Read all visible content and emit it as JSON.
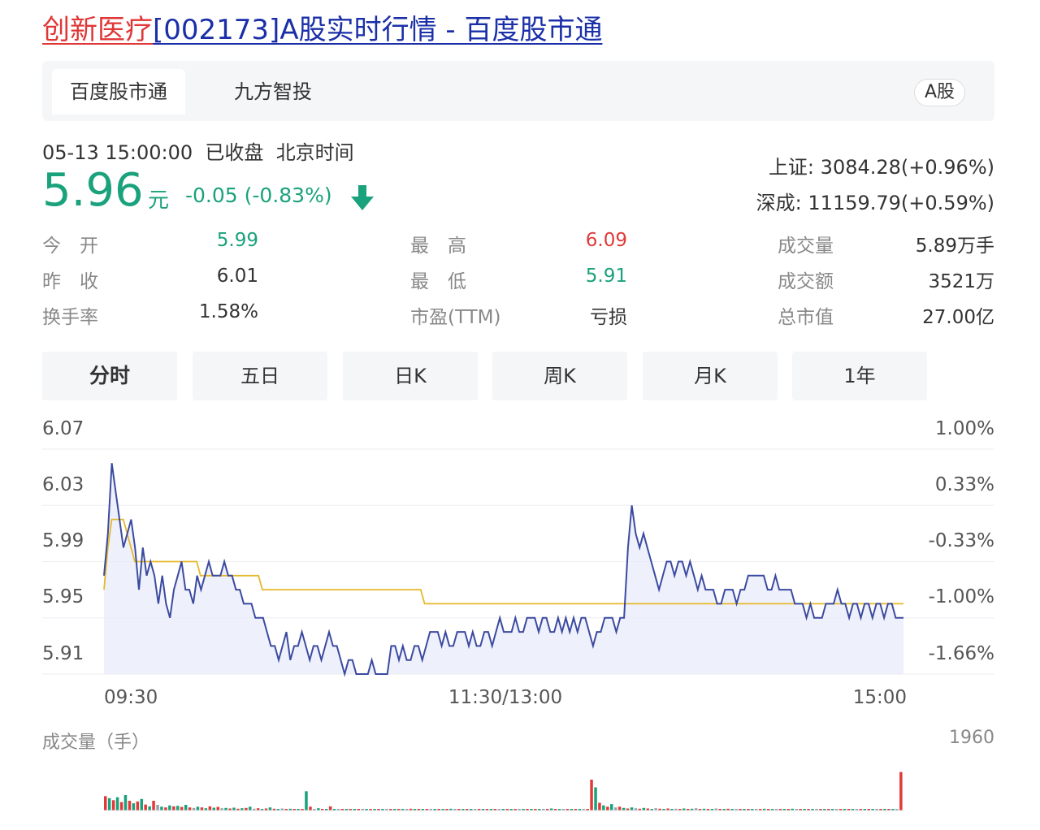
{
  "header": {
    "title_part1": "创新医疗",
    "title_part2": "[002173]A股实时行情 - 百度股市通"
  },
  "source_tabs": [
    {
      "label": "百度股市通",
      "active": true
    },
    {
      "label": "九方智投",
      "active": false
    }
  ],
  "market_badge": "A股",
  "status": {
    "datetime": "05-13 15:00:00",
    "state": "已收盘",
    "timezone": "北京时间"
  },
  "quote": {
    "price": "5.96",
    "unit": "元",
    "change": "-0.05 (-0.83%)",
    "direction_icon": "arrow-down-icon",
    "color": "#1aa27c"
  },
  "indices": [
    {
      "label": "上证:",
      "value": "3084.28(+0.96%)"
    },
    {
      "label": "深成:",
      "value": "11159.79(+0.59%)"
    }
  ],
  "stats": [
    {
      "label": "今　开",
      "value": "5.99",
      "color": "#1aa27c"
    },
    {
      "label": "昨　收",
      "value": "6.01",
      "color": "#333333"
    },
    {
      "label": "换手率",
      "value": "1.58%",
      "color": "#333333"
    },
    {
      "label": "最　高",
      "value": "6.09",
      "color": "#e03a3a"
    },
    {
      "label": "最　低",
      "value": "5.91",
      "color": "#1aa27c"
    },
    {
      "label": "市盈(TTM)",
      "value": "亏损",
      "color": "#333333"
    },
    {
      "label": "成交量",
      "value": "5.89万手",
      "color": "#333333"
    },
    {
      "label": "成交额",
      "value": "3521万",
      "color": "#333333"
    },
    {
      "label": "总市值",
      "value": "27.00亿",
      "color": "#333333"
    }
  ],
  "chart_tabs": [
    {
      "label": "分时",
      "active": true
    },
    {
      "label": "五日",
      "active": false
    },
    {
      "label": "日K",
      "active": false
    },
    {
      "label": "周K",
      "active": false
    },
    {
      "label": "月K",
      "active": false
    },
    {
      "label": "1年",
      "active": false
    }
  ],
  "chart_data": {
    "type": "line",
    "price_ticks": [
      "6.07",
      "6.03",
      "5.99",
      "5.95",
      "5.91"
    ],
    "percent_ticks": [
      "1.00%",
      "0.33%",
      "-0.33%",
      "-1.00%",
      "-1.66%"
    ],
    "x_ticks": [
      "09:30",
      "11:30/13:00",
      "15:00"
    ],
    "ylim": [
      5.91,
      6.07
    ],
    "grid": true,
    "series": [
      {
        "color": "#3b4aa0",
        "area_fill": "#e8ecfa",
        "values": [
          5.98,
          6.01,
          6.06,
          6.04,
          6.02,
          6.0,
          6.01,
          6.02,
          6.0,
          5.97,
          6.0,
          5.98,
          5.99,
          5.98,
          5.96,
          5.98,
          5.96,
          5.95,
          5.97,
          5.98,
          5.99,
          5.97,
          5.97,
          5.96,
          5.98,
          5.97,
          5.98,
          5.99,
          5.98,
          5.98,
          5.98,
          5.99,
          5.98,
          5.98,
          5.97,
          5.97,
          5.96,
          5.96,
          5.96,
          5.95,
          5.95,
          5.95,
          5.94,
          5.93,
          5.93,
          5.92,
          5.93,
          5.94,
          5.92,
          5.93,
          5.93,
          5.94,
          5.93,
          5.92,
          5.93,
          5.93,
          5.92,
          5.93,
          5.94,
          5.93,
          5.93,
          5.92,
          5.91,
          5.92,
          5.92,
          5.91,
          5.91,
          5.91,
          5.91,
          5.92,
          5.91,
          5.91,
          5.91,
          5.91,
          5.93,
          5.93,
          5.92,
          5.93,
          5.92,
          5.92,
          5.93,
          5.93,
          5.92,
          5.93,
          5.94,
          5.94,
          5.94,
          5.93,
          5.94,
          5.93,
          5.93,
          5.94,
          5.94,
          5.94,
          5.93,
          5.94,
          5.93,
          5.93,
          5.94,
          5.94,
          5.93,
          5.94,
          5.95,
          5.94,
          5.94,
          5.94,
          5.95,
          5.94,
          5.94,
          5.95,
          5.95,
          5.95,
          5.94,
          5.95,
          5.95,
          5.94,
          5.94,
          5.95,
          5.94,
          5.95,
          5.94,
          5.95,
          5.94,
          5.95,
          5.95,
          5.94,
          5.93,
          5.94,
          5.94,
          5.95,
          5.95,
          5.95,
          5.94,
          5.95,
          5.95,
          6.0,
          6.03,
          6.01,
          6.0,
          6.01,
          6.0,
          5.99,
          5.98,
          5.97,
          5.98,
          5.99,
          5.99,
          5.98,
          5.99,
          5.99,
          5.98,
          5.99,
          5.98,
          5.97,
          5.98,
          5.97,
          5.97,
          5.97,
          5.96,
          5.96,
          5.97,
          5.97,
          5.97,
          5.96,
          5.97,
          5.97,
          5.98,
          5.98,
          5.98,
          5.98,
          5.98,
          5.97,
          5.97,
          5.98,
          5.97,
          5.97,
          5.97,
          5.97,
          5.96,
          5.96,
          5.96,
          5.95,
          5.96,
          5.95,
          5.95,
          5.95,
          5.96,
          5.96,
          5.96,
          5.97,
          5.96,
          5.96,
          5.95,
          5.96,
          5.96,
          5.95,
          5.96,
          5.96,
          5.95,
          5.96,
          5.96,
          5.95,
          5.96,
          5.96,
          5.95,
          5.95,
          5.95
        ]
      },
      {
        "color": "#e5b82b",
        "values": [
          5.97,
          6.0,
          6.02,
          6.02,
          6.02,
          6.02,
          6.01,
          6.0,
          5.99,
          5.99,
          5.99,
          5.99,
          5.99,
          5.99,
          5.99,
          5.99,
          5.99,
          5.99,
          5.99,
          5.99,
          5.99,
          5.99,
          5.99,
          5.99,
          5.99,
          5.98,
          5.98,
          5.98,
          5.98,
          5.98,
          5.98,
          5.98,
          5.98,
          5.98,
          5.98,
          5.98,
          5.98,
          5.98,
          5.98,
          5.98,
          5.98,
          5.97,
          5.97,
          5.97,
          5.97,
          5.97,
          5.97,
          5.97,
          5.97,
          5.97,
          5.97,
          5.97,
          5.97,
          5.97,
          5.97,
          5.97,
          5.97,
          5.97,
          5.97,
          5.97,
          5.97,
          5.97,
          5.97,
          5.97,
          5.97,
          5.97,
          5.97,
          5.97,
          5.97,
          5.97,
          5.97,
          5.97,
          5.97,
          5.97,
          5.97,
          5.97,
          5.97,
          5.97,
          5.97,
          5.97,
          5.97,
          5.97,
          5.97,
          5.96,
          5.96,
          5.96,
          5.96,
          5.96,
          5.96,
          5.96,
          5.96,
          5.96,
          5.96,
          5.96,
          5.96,
          5.96,
          5.96,
          5.96,
          5.96,
          5.96,
          5.96,
          5.96,
          5.96,
          5.96,
          5.96,
          5.96,
          5.96,
          5.96,
          5.96,
          5.96,
          5.96,
          5.96,
          5.96,
          5.96,
          5.96,
          5.96,
          5.96,
          5.96,
          5.96,
          5.96,
          5.96,
          5.96,
          5.96,
          5.96,
          5.96,
          5.96,
          5.96,
          5.96,
          5.96,
          5.96,
          5.96,
          5.96,
          5.96,
          5.96,
          5.96,
          5.96,
          5.96,
          5.96,
          5.96,
          5.96,
          5.96,
          5.96,
          5.96,
          5.96,
          5.96,
          5.96,
          5.96,
          5.96,
          5.96,
          5.96,
          5.96,
          5.96,
          5.96,
          5.96,
          5.96,
          5.96,
          5.96,
          5.96,
          5.96,
          5.96,
          5.96,
          5.96,
          5.96,
          5.96,
          5.96,
          5.96,
          5.96,
          5.96,
          5.96,
          5.96,
          5.96,
          5.96,
          5.96,
          5.96,
          5.96,
          5.96,
          5.96,
          5.96,
          5.96,
          5.96,
          5.96,
          5.96,
          5.96,
          5.96,
          5.96,
          5.96,
          5.96,
          5.96,
          5.96,
          5.96,
          5.96,
          5.96,
          5.96,
          5.96,
          5.96,
          5.96,
          5.96,
          5.96,
          5.96,
          5.96,
          5.96,
          5.96,
          5.96,
          5.96,
          5.96,
          5.96,
          5.96,
          5.96
        ]
      }
    ]
  },
  "volume": {
    "label": "成交量（手）",
    "max_label": "1960",
    "max_value": 1960,
    "up_color": "#e03a3a",
    "down_color": "#1aa27c",
    "flat_color": "#9aa0aa",
    "values": [
      560,
      480,
      400,
      520,
      330,
      600,
      380,
      280,
      350,
      450,
      230,
      160,
      380,
      220,
      150,
      120,
      200,
      160,
      180,
      140,
      220,
      120,
      100,
      150,
      120,
      90,
      160,
      110,
      140,
      90,
      100,
      80,
      110,
      70,
      90,
      100,
      150,
      70,
      90,
      60,
      80,
      120,
      70,
      60,
      80,
      40,
      70,
      50,
      40,
      60,
      750,
      150,
      60,
      90,
      40,
      50,
      160,
      60,
      40,
      50,
      60,
      30,
      50,
      40,
      60,
      30,
      40,
      50,
      30,
      40,
      60,
      30,
      40,
      50,
      30,
      40,
      70,
      30,
      40,
      50,
      40,
      30,
      50,
      40,
      60,
      30,
      70,
      40,
      50,
      30,
      40,
      50,
      40,
      30,
      50,
      40,
      60,
      30,
      40,
      50,
      30,
      40,
      60,
      30,
      40,
      50,
      30,
      40,
      60,
      30,
      40,
      80,
      30,
      40,
      50,
      30,
      40,
      60,
      30,
      40,
      50,
      1200,
      900,
      300,
      200,
      150,
      250,
      120,
      150,
      100,
      80,
      120,
      90,
      70,
      100,
      80,
      60,
      90,
      70,
      60,
      80,
      50,
      70,
      60,
      80,
      50,
      70,
      90,
      60,
      70,
      50,
      60,
      80,
      50,
      60,
      70,
      50,
      60,
      40,
      60,
      50,
      40,
      60,
      50,
      70,
      40,
      60,
      50,
      40,
      60,
      50,
      70,
      40,
      50,
      60,
      40,
      50,
      60,
      40,
      50,
      60,
      40,
      50,
      60,
      40,
      50,
      60,
      40,
      50,
      60,
      40,
      50,
      60,
      40,
      50,
      60,
      40,
      50,
      1500
    ],
    "dirs": [
      1,
      -1,
      1,
      -1,
      1,
      -1,
      1,
      -1,
      1,
      -1,
      1,
      -1,
      1,
      0,
      -1,
      1,
      -1,
      1,
      -1,
      1,
      -1,
      1,
      0,
      -1,
      1,
      -1,
      1,
      -1,
      1,
      0,
      -1,
      1,
      -1,
      1,
      -1,
      1,
      -1,
      0,
      1,
      -1,
      1,
      -1,
      1,
      -1,
      0,
      1,
      -1,
      1,
      -1,
      1,
      -1,
      1,
      0,
      -1,
      1,
      -1,
      1,
      -1,
      0,
      1,
      -1,
      1,
      -1,
      1,
      0,
      -1,
      1,
      -1,
      1,
      -1,
      0,
      1,
      -1,
      1,
      -1,
      0,
      1,
      -1,
      1,
      -1,
      1,
      0,
      -1,
      1,
      -1,
      1,
      -1,
      0,
      1,
      -1,
      1,
      -1,
      0,
      1,
      -1,
      1,
      -1,
      1,
      0,
      -1,
      1,
      -1,
      1,
      0,
      -1,
      1,
      -1,
      1,
      -1,
      0,
      1,
      -1,
      1,
      -1,
      0,
      1,
      -1,
      1,
      -1,
      0,
      1,
      1,
      -1,
      1,
      -1,
      1,
      -1,
      0,
      1,
      -1,
      1,
      -1,
      0,
      1,
      -1,
      1,
      -1,
      0,
      1,
      -1,
      1,
      -1,
      0,
      1,
      -1,
      1,
      -1,
      0,
      1,
      -1,
      1,
      -1,
      0,
      1,
      -1,
      1,
      -1,
      0,
      1,
      -1,
      1,
      -1,
      0,
      1,
      -1,
      1,
      -1,
      0,
      1,
      -1,
      1,
      -1,
      0,
      1,
      -1,
      1,
      -1,
      0,
      1,
      -1,
      1,
      -1,
      0,
      1,
      -1,
      1,
      -1,
      0,
      1,
      -1,
      1,
      -1,
      0,
      1,
      -1,
      1,
      -1,
      0,
      1,
      -1,
      1,
      -1,
      0
    ]
  }
}
